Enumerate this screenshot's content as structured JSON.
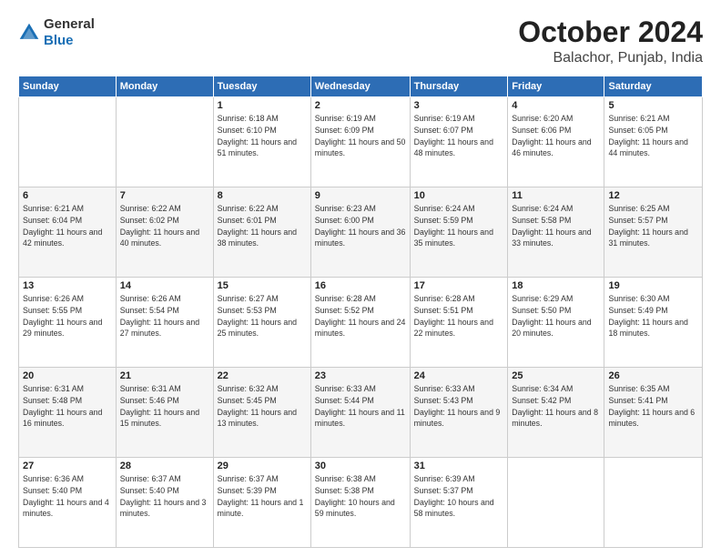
{
  "logo": {
    "text_general": "General",
    "text_blue": "Blue"
  },
  "header": {
    "month": "October 2024",
    "location": "Balachor, Punjab, India"
  },
  "weekdays": [
    "Sunday",
    "Monday",
    "Tuesday",
    "Wednesday",
    "Thursday",
    "Friday",
    "Saturday"
  ],
  "weeks": [
    [
      null,
      null,
      {
        "day": 1,
        "sunrise": "Sunrise: 6:18 AM",
        "sunset": "Sunset: 6:10 PM",
        "daylight": "Daylight: 11 hours and 51 minutes."
      },
      {
        "day": 2,
        "sunrise": "Sunrise: 6:19 AM",
        "sunset": "Sunset: 6:09 PM",
        "daylight": "Daylight: 11 hours and 50 minutes."
      },
      {
        "day": 3,
        "sunrise": "Sunrise: 6:19 AM",
        "sunset": "Sunset: 6:07 PM",
        "daylight": "Daylight: 11 hours and 48 minutes."
      },
      {
        "day": 4,
        "sunrise": "Sunrise: 6:20 AM",
        "sunset": "Sunset: 6:06 PM",
        "daylight": "Daylight: 11 hours and 46 minutes."
      },
      {
        "day": 5,
        "sunrise": "Sunrise: 6:21 AM",
        "sunset": "Sunset: 6:05 PM",
        "daylight": "Daylight: 11 hours and 44 minutes."
      }
    ],
    [
      {
        "day": 6,
        "sunrise": "Sunrise: 6:21 AM",
        "sunset": "Sunset: 6:04 PM",
        "daylight": "Daylight: 11 hours and 42 minutes."
      },
      {
        "day": 7,
        "sunrise": "Sunrise: 6:22 AM",
        "sunset": "Sunset: 6:02 PM",
        "daylight": "Daylight: 11 hours and 40 minutes."
      },
      {
        "day": 8,
        "sunrise": "Sunrise: 6:22 AM",
        "sunset": "Sunset: 6:01 PM",
        "daylight": "Daylight: 11 hours and 38 minutes."
      },
      {
        "day": 9,
        "sunrise": "Sunrise: 6:23 AM",
        "sunset": "Sunset: 6:00 PM",
        "daylight": "Daylight: 11 hours and 36 minutes."
      },
      {
        "day": 10,
        "sunrise": "Sunrise: 6:24 AM",
        "sunset": "Sunset: 5:59 PM",
        "daylight": "Daylight: 11 hours and 35 minutes."
      },
      {
        "day": 11,
        "sunrise": "Sunrise: 6:24 AM",
        "sunset": "Sunset: 5:58 PM",
        "daylight": "Daylight: 11 hours and 33 minutes."
      },
      {
        "day": 12,
        "sunrise": "Sunrise: 6:25 AM",
        "sunset": "Sunset: 5:57 PM",
        "daylight": "Daylight: 11 hours and 31 minutes."
      }
    ],
    [
      {
        "day": 13,
        "sunrise": "Sunrise: 6:26 AM",
        "sunset": "Sunset: 5:55 PM",
        "daylight": "Daylight: 11 hours and 29 minutes."
      },
      {
        "day": 14,
        "sunrise": "Sunrise: 6:26 AM",
        "sunset": "Sunset: 5:54 PM",
        "daylight": "Daylight: 11 hours and 27 minutes."
      },
      {
        "day": 15,
        "sunrise": "Sunrise: 6:27 AM",
        "sunset": "Sunset: 5:53 PM",
        "daylight": "Daylight: 11 hours and 25 minutes."
      },
      {
        "day": 16,
        "sunrise": "Sunrise: 6:28 AM",
        "sunset": "Sunset: 5:52 PM",
        "daylight": "Daylight: 11 hours and 24 minutes."
      },
      {
        "day": 17,
        "sunrise": "Sunrise: 6:28 AM",
        "sunset": "Sunset: 5:51 PM",
        "daylight": "Daylight: 11 hours and 22 minutes."
      },
      {
        "day": 18,
        "sunrise": "Sunrise: 6:29 AM",
        "sunset": "Sunset: 5:50 PM",
        "daylight": "Daylight: 11 hours and 20 minutes."
      },
      {
        "day": 19,
        "sunrise": "Sunrise: 6:30 AM",
        "sunset": "Sunset: 5:49 PM",
        "daylight": "Daylight: 11 hours and 18 minutes."
      }
    ],
    [
      {
        "day": 20,
        "sunrise": "Sunrise: 6:31 AM",
        "sunset": "Sunset: 5:48 PM",
        "daylight": "Daylight: 11 hours and 16 minutes."
      },
      {
        "day": 21,
        "sunrise": "Sunrise: 6:31 AM",
        "sunset": "Sunset: 5:46 PM",
        "daylight": "Daylight: 11 hours and 15 minutes."
      },
      {
        "day": 22,
        "sunrise": "Sunrise: 6:32 AM",
        "sunset": "Sunset: 5:45 PM",
        "daylight": "Daylight: 11 hours and 13 minutes."
      },
      {
        "day": 23,
        "sunrise": "Sunrise: 6:33 AM",
        "sunset": "Sunset: 5:44 PM",
        "daylight": "Daylight: 11 hours and 11 minutes."
      },
      {
        "day": 24,
        "sunrise": "Sunrise: 6:33 AM",
        "sunset": "Sunset: 5:43 PM",
        "daylight": "Daylight: 11 hours and 9 minutes."
      },
      {
        "day": 25,
        "sunrise": "Sunrise: 6:34 AM",
        "sunset": "Sunset: 5:42 PM",
        "daylight": "Daylight: 11 hours and 8 minutes."
      },
      {
        "day": 26,
        "sunrise": "Sunrise: 6:35 AM",
        "sunset": "Sunset: 5:41 PM",
        "daylight": "Daylight: 11 hours and 6 minutes."
      }
    ],
    [
      {
        "day": 27,
        "sunrise": "Sunrise: 6:36 AM",
        "sunset": "Sunset: 5:40 PM",
        "daylight": "Daylight: 11 hours and 4 minutes."
      },
      {
        "day": 28,
        "sunrise": "Sunrise: 6:37 AM",
        "sunset": "Sunset: 5:40 PM",
        "daylight": "Daylight: 11 hours and 3 minutes."
      },
      {
        "day": 29,
        "sunrise": "Sunrise: 6:37 AM",
        "sunset": "Sunset: 5:39 PM",
        "daylight": "Daylight: 11 hours and 1 minute."
      },
      {
        "day": 30,
        "sunrise": "Sunrise: 6:38 AM",
        "sunset": "Sunset: 5:38 PM",
        "daylight": "Daylight: 10 hours and 59 minutes."
      },
      {
        "day": 31,
        "sunrise": "Sunrise: 6:39 AM",
        "sunset": "Sunset: 5:37 PM",
        "daylight": "Daylight: 10 hours and 58 minutes."
      },
      null,
      null
    ]
  ]
}
